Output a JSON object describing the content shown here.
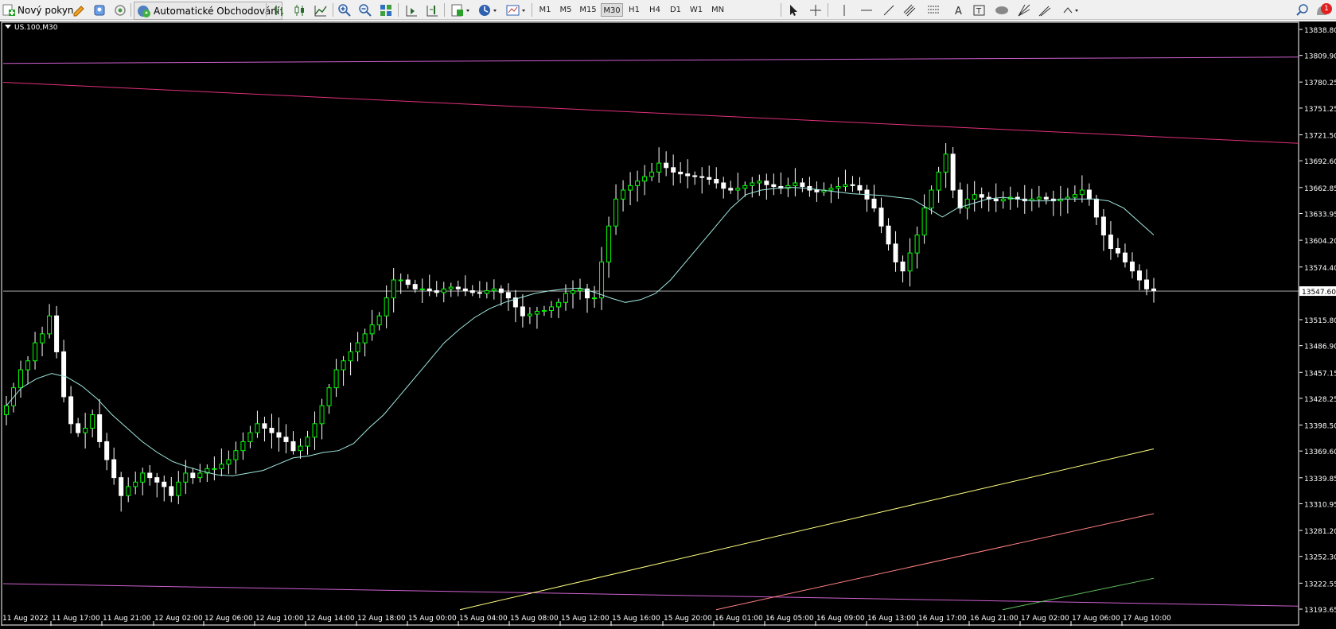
{
  "toolbar": {
    "new_order_label": "Nový pokyn",
    "auto_trading_label": "Automatické Obchodování",
    "timeframes": [
      "M1",
      "M5",
      "M15",
      "M30",
      "H1",
      "H4",
      "D1",
      "W1",
      "MN"
    ],
    "active_timeframe": "M30",
    "notification_count": "1"
  },
  "chart": {
    "symbol_label": "US.100,M30",
    "current_price_label": "13547.60"
  },
  "chart_data": {
    "type": "candlestick",
    "symbol": "US.100",
    "timeframe": "M30",
    "y_tick_labels": [
      "13838.80",
      "13809.90",
      "13780.25",
      "13751.25",
      "13721.50",
      "13692.60",
      "13662.85",
      "13633.95",
      "13604.20",
      "13574.40",
      "13547.60",
      "13515.80",
      "13486.90",
      "13457.15",
      "13428.25",
      "13398.50",
      "13369.60",
      "13339.85",
      "13310.95",
      "13281.20",
      "13252.30",
      "13222.55",
      "13193.65"
    ],
    "x_tick_labels": [
      "11 Aug 2022",
      "11 Aug 17:00",
      "11 Aug 21:00",
      "12 Aug 02:00",
      "12 Aug 06:00",
      "12 Aug 10:00",
      "12 Aug 14:00",
      "12 Aug 18:00",
      "15 Aug 00:00",
      "15 Aug 04:00",
      "15 Aug 08:00",
      "15 Aug 12:00",
      "15 Aug 16:00",
      "15 Aug 20:00",
      "16 Aug 01:00",
      "16 Aug 05:00",
      "16 Aug 09:00",
      "16 Aug 13:00",
      "16 Aug 17:00",
      "16 Aug 21:00",
      "17 Aug 02:00",
      "17 Aug 06:00",
      "17 Aug 10:00"
    ],
    "y_range": [
      13193.65,
      13838.8
    ],
    "current_price": 13547.6,
    "candle_closes": [
      13420,
      13440,
      13460,
      13470,
      13490,
      13500,
      13520,
      13480,
      13430,
      13400,
      13390,
      13395,
      13410,
      13380,
      13360,
      13340,
      13320,
      13330,
      13335,
      13345,
      13340,
      13335,
      13330,
      13320,
      13335,
      13345,
      13340,
      13345,
      13350,
      13350,
      13355,
      13360,
      13370,
      13380,
      13390,
      13400,
      13395,
      13390,
      13385,
      13380,
      13370,
      13375,
      13385,
      13400,
      13420,
      13440,
      13460,
      13470,
      13480,
      13490,
      13500,
      13510,
      13520,
      13540,
      13560,
      13560,
      13555,
      13550,
      13550,
      13548,
      13546,
      13550,
      13552,
      13550,
      13548,
      13546,
      13545,
      13548,
      13550,
      13546,
      13540,
      13530,
      13520,
      13522,
      13525,
      13526,
      13530,
      13535,
      13545,
      13548,
      13550,
      13540,
      13540,
      13580,
      13620,
      13650,
      13660,
      13665,
      13670,
      13675,
      13680,
      13690,
      13685,
      13680,
      13678,
      13676,
      13675,
      13674,
      13672,
      13668,
      13662,
      13660,
      13662,
      13665,
      13668,
      13670,
      13666,
      13664,
      13662,
      13665,
      13668,
      13664,
      13660,
      13658,
      13660,
      13662,
      13664,
      13666,
      13665,
      13660,
      13650,
      13640,
      13620,
      13600,
      13580,
      13570,
      13590,
      13610,
      13640,
      13660,
      13680,
      13700,
      13660,
      13640,
      13650,
      13655,
      13652,
      13650,
      13648,
      13650,
      13652,
      13650,
      13648,
      13650,
      13652,
      13650,
      13648,
      13650,
      13652,
      13655,
      13660,
      13650,
      13630,
      13610,
      13595,
      13590,
      13580,
      13570,
      13560,
      13550,
      13548
    ],
    "moving_average": [
      13420,
      13440,
      13450,
      13456,
      13452,
      13442,
      13428,
      13410,
      13395,
      13380,
      13368,
      13358,
      13352,
      13347,
      13343,
      13342,
      13345,
      13348,
      13355,
      13362,
      13364,
      13368,
      13370,
      13378,
      13395,
      13410,
      13430,
      13450,
      13470,
      13490,
      13505,
      13518,
      13528,
      13535,
      13540,
      13545,
      13548,
      13550,
      13551,
      13546,
      13540,
      13535,
      13538,
      13545,
      13560,
      13580,
      13600,
      13620,
      13640,
      13655,
      13660,
      13662,
      13663,
      13662,
      13660,
      13658,
      13656,
      13655,
      13654,
      13652,
      13650,
      13640,
      13630,
      13640,
      13645,
      13650,
      13652,
      13650,
      13648,
      13648,
      13650,
      13650,
      13650,
      13648,
      13640,
      13625,
      13610
    ],
    "trend_lines": [
      {
        "name": "upper-resistance-violet",
        "color": "#d060d0",
        "points": [
          [
            0,
            13801
          ],
          [
            1,
            13808
          ]
        ]
      },
      {
        "name": "upper-resistance-pink",
        "color": "#e0307a",
        "points": [
          [
            0,
            13780
          ],
          [
            1,
            13712
          ]
        ]
      },
      {
        "name": "lower-support-violet",
        "color": "#d060d0",
        "points": [
          [
            0,
            13222
          ],
          [
            1,
            13197
          ]
        ]
      },
      {
        "name": "channel-yellow",
        "color": "#ffff80",
        "points": [
          [
            0,
            13193
          ],
          [
            1,
            13372
          ]
        ]
      },
      {
        "name": "channel-salmon",
        "color": "#ff8080",
        "points": [
          [
            0,
            13193
          ],
          [
            1,
            13300
          ]
        ]
      },
      {
        "name": "channel-green",
        "color": "#60c060",
        "points": [
          [
            0,
            13193
          ],
          [
            1,
            13228
          ]
        ]
      }
    ],
    "colors": {
      "bull": "#00ff00",
      "bear": "#ffffff",
      "background": "#000000",
      "ma": "#a0e8e0",
      "grid": "none",
      "axis_text": "#ffffff"
    }
  }
}
